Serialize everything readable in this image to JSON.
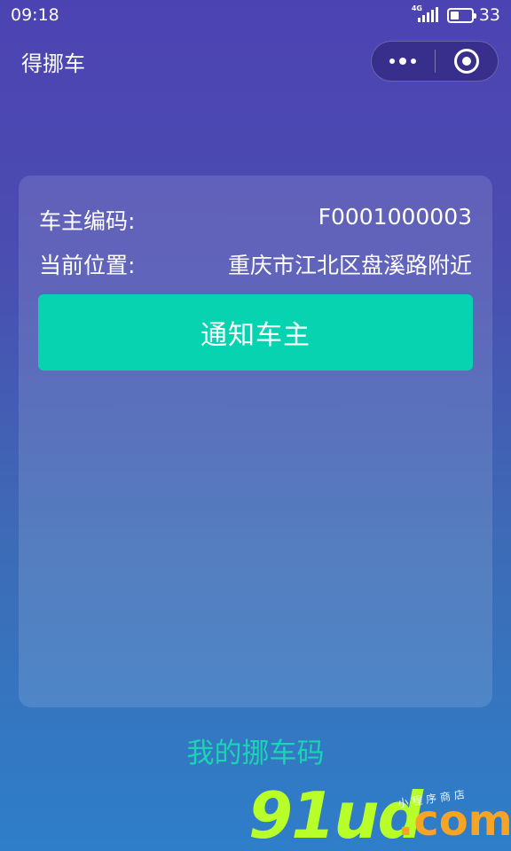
{
  "status_bar": {
    "time": "09:18",
    "network": "4G",
    "battery": "33"
  },
  "nav": {
    "title": "得挪车"
  },
  "card": {
    "owner_code_label": "车主编码:",
    "owner_code_value": "F0001000003",
    "location_label": "当前位置:",
    "location_value": "重庆市江北区盘溪路附近",
    "notify_button": "通知车主"
  },
  "footer": {
    "my_code_link": "我的挪车码"
  },
  "watermark": {
    "main": "91ud",
    "suffix": ".com",
    "small": "小程序商店"
  },
  "colors": {
    "accent": "#07d3b0",
    "link": "#1cd3b4",
    "background_top": "#4c43b3",
    "background_bottom": "#2e7ec9"
  }
}
